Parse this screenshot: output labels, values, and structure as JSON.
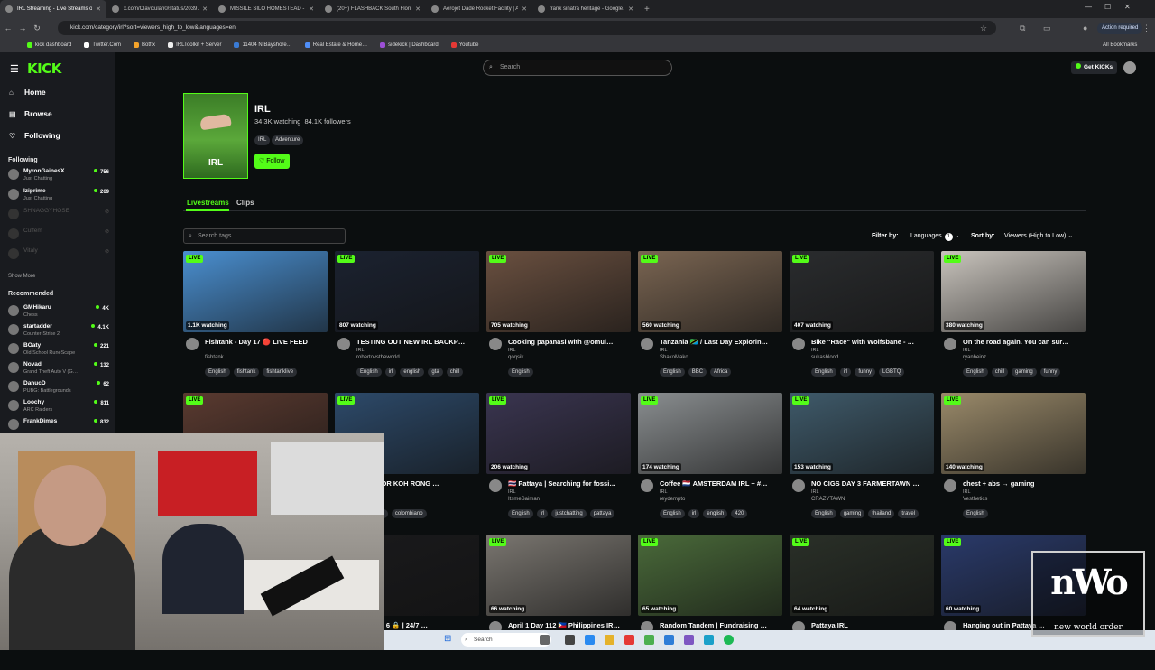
{
  "browser": {
    "tabs": [
      {
        "title": "IRL Streaming - Live Streams on Kick",
        "active": true
      },
      {
        "title": "x.com/Claviculari0/status/2039…",
        "active": false
      },
      {
        "title": "MISSILE SILO HOMESTEAD - G…",
        "active": false
      },
      {
        "title": "(20+) FLASHBACK South Florid…",
        "active": false
      },
      {
        "title": "Aerojet Dade Rocket Facility | A…",
        "active": false
      },
      {
        "title": "frank sinatra heritage - Google…",
        "active": false
      }
    ],
    "url": "kick.com/category/irl?sort=viewers_high_to_low&languages=en",
    "action_required": "Action required",
    "bookmarks": [
      "kick dashboard",
      "Twitter.Com",
      "Botfix",
      "IRLToolkit + Server",
      "11404 N Bayshore…",
      "Real Estate & Home…",
      "sidekick | Dashboard",
      "Youtube"
    ],
    "all_bookmarks": "All Bookmarks"
  },
  "kick": {
    "logo": "KICK",
    "search_placeholder": "Search",
    "get_kicks": "Get KICKs",
    "nav": {
      "home": "Home",
      "browse": "Browse",
      "following": "Following"
    },
    "following_header": "Following",
    "following": [
      {
        "name": "MyronGainesX",
        "game": "Just Chatting",
        "viewers": "756",
        "online": true
      },
      {
        "name": "Iziprime",
        "game": "Just Chatting",
        "viewers": "269",
        "online": true
      },
      {
        "name": "SHNAGGYHOSE",
        "game": "",
        "viewers": "",
        "online": false
      },
      {
        "name": "Cuffem",
        "game": "",
        "viewers": "",
        "online": false
      },
      {
        "name": "Vitaly",
        "game": "",
        "viewers": "",
        "online": false
      }
    ],
    "show_more": "Show More",
    "recommended_header": "Recommended",
    "recommended": [
      {
        "name": "GMHikaru",
        "game": "Chess",
        "viewers": "4K"
      },
      {
        "name": "startadder",
        "game": "Counter-Strike 2",
        "viewers": "4.1K"
      },
      {
        "name": "BOaty",
        "game": "Old School RuneScape",
        "viewers": "221"
      },
      {
        "name": "Novad",
        "game": "Grand Theft Auto V (G…",
        "viewers": "132"
      },
      {
        "name": "DanucD",
        "game": "PUBG: Battlegrounds",
        "viewers": "62"
      },
      {
        "name": "Loochy",
        "game": "ARC Raiders",
        "viewers": "811"
      },
      {
        "name": "FrankDimes",
        "game": "",
        "viewers": "832"
      }
    ],
    "category": {
      "name": "IRL",
      "cover_label": "IRL",
      "watching": "34.3K watching",
      "followers": "84.1K followers",
      "tags": [
        "IRL",
        "Adventure"
      ],
      "follow": "Follow"
    },
    "tabs": {
      "livestreams": "Livestreams",
      "clips": "Clips"
    },
    "tag_search_placeholder": "Search tags",
    "filter_label": "Filter by:",
    "languages": "Languages",
    "languages_count": "1",
    "sort_label": "Sort by:",
    "sort_value": "Viewers (High to Low)",
    "live_label": "LIVE",
    "streams": [
      {
        "watching": "1.1K watching",
        "title": "Fishtank - Day 17 🔴 LIVE FEED",
        "category": "",
        "user": "fishtank",
        "tags": [
          "English",
          "fishtank",
          "fishtanklive"
        ],
        "thumb": "#4a8fd0"
      },
      {
        "watching": "807 watching",
        "title": "TESTING OUT NEW IRL BACKP…",
        "category": "IRL",
        "user": "robertovstheworld",
        "tags": [
          "English",
          "irl",
          "english",
          "gta",
          "chill"
        ],
        "thumb": "#1b2230"
      },
      {
        "watching": "705 watching",
        "title": "Cooking papanasi with @omul…",
        "category": "IRL",
        "user": "qoqsik",
        "tags": [
          "English"
        ],
        "thumb": "#6a5040"
      },
      {
        "watching": "560 watching",
        "title": "Tanzania 🇹🇿 / Last Day Explorin…",
        "category": "IRL",
        "user": "ShakoMako",
        "tags": [
          "English",
          "BBC",
          "Africa"
        ],
        "thumb": "#7a6552"
      },
      {
        "watching": "407 watching",
        "title": "Bike \"Race\" with Wolfsbane - …",
        "category": "IRL",
        "user": "sukasblood",
        "tags": [
          "English",
          "irl",
          "funny",
          "LGBTQ"
        ],
        "thumb": "#2a2c2e"
      },
      {
        "watching": "380 watching",
        "title": "On the road again. You can sur…",
        "category": "IRL",
        "user": "ryanheinz",
        "tags": [
          "English",
          "chill",
          "gaming",
          "funny"
        ],
        "thumb": "#c9c4bd"
      },
      {
        "watching": "",
        "title": "",
        "category": "",
        "user": "",
        "tags": [],
        "thumb": "#5a3a30"
      },
      {
        "watching": "",
        "title": "…ING FOR KOH RONG …",
        "category": "",
        "user": "…VELS",
        "tags": [
          "18+",
          "irl",
          "colombiano"
        ],
        "thumb": "#2d4a6a"
      },
      {
        "watching": "206 watching",
        "title": "🇹🇭 Pattaya | Searching for fossi…",
        "category": "IRL",
        "user": "ItsmeSaiman",
        "tags": [
          "English",
          "irl",
          "justchatting",
          "pattaya"
        ],
        "thumb": "#3a3550"
      },
      {
        "watching": "174 watching",
        "title": "Coffee 🇳🇱 AMSTERDAM IRL + #…",
        "category": "IRL",
        "user": "reydempto",
        "tags": [
          "English",
          "irl",
          "english",
          "420"
        ],
        "thumb": "#8a8e90"
      },
      {
        "watching": "153 watching",
        "title": "NO CIGS DAY 3 FARMERTAWN …",
        "category": "IRL",
        "user": "CRAZYTAWN",
        "tags": [
          "English",
          "gaming",
          "thailand",
          "travel"
        ],
        "thumb": "#3f5a6a"
      },
      {
        "watching": "140 watching",
        "title": "chest + abs → gaming",
        "category": "IRL",
        "user": "Vesthetics",
        "tags": [
          "English"
        ],
        "thumb": "#9a8a6a"
      },
      {
        "watching": "",
        "title": "",
        "category": "",
        "user": "",
        "tags": [],
        "thumb": "#2a2a2a"
      },
      {
        "watching": "",
        "title": "…M DAY 6 🔒 | 24/7 …",
        "category": "",
        "user": "",
        "tags": [],
        "thumb": "#1a1a1c"
      },
      {
        "watching": "66 watching",
        "title": "April 1 Day 112 🇵🇭 Philippines IR…",
        "category": "",
        "user": "",
        "tags": [],
        "thumb": "#7a7670"
      },
      {
        "watching": "65 watching",
        "title": "Random Tandem | Fundraising …",
        "category": "",
        "user": "",
        "tags": [],
        "thumb": "#4a6a3a"
      },
      {
        "watching": "64 watching",
        "title": "Pattaya IRL",
        "category": "",
        "user": "",
        "tags": [],
        "thumb": "#2a3028"
      },
      {
        "watching": "60 watching",
        "title": "Hanging out in Pattaya …",
        "category": "",
        "user": "",
        "tags": [],
        "thumb": "#2a3a6a"
      }
    ]
  },
  "taskbar": {
    "search_placeholder": "Search"
  },
  "overlay": {
    "logo": "nWo",
    "subtitle": "new world order"
  }
}
